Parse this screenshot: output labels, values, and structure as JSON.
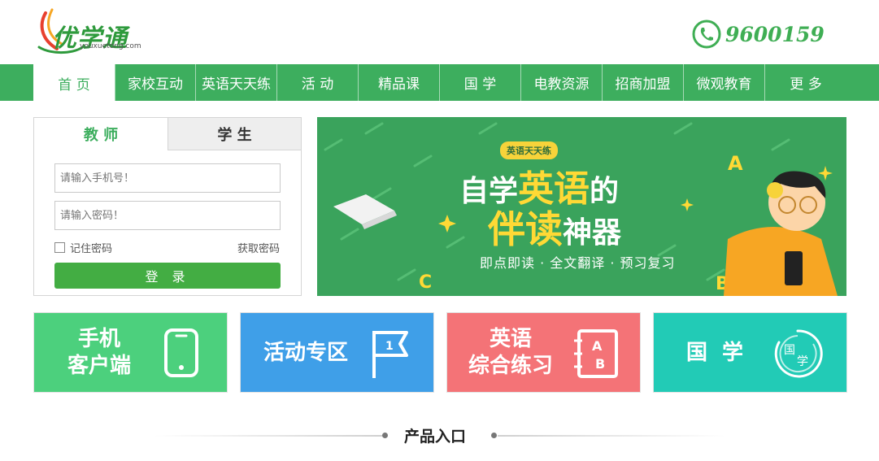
{
  "header": {
    "logo_text": "优学通",
    "logo_sub": "youxuetong.com",
    "phone": "9600159"
  },
  "nav": {
    "items": [
      {
        "label": "首  页"
      },
      {
        "label": "家校互动"
      },
      {
        "label": "英语天天练"
      },
      {
        "label": "活  动"
      },
      {
        "label": "精品课"
      },
      {
        "label": "国  学"
      },
      {
        "label": "电教资源"
      },
      {
        "label": "招商加盟"
      },
      {
        "label": "微观教育"
      },
      {
        "label": "更  多"
      }
    ]
  },
  "login": {
    "tab_teacher": "教 师",
    "tab_student": "学 生",
    "phone_placeholder": "请输入手机号！",
    "password_placeholder": "请输入密码！",
    "remember_label": "记住密码",
    "get_password": "获取密码",
    "submit": "登 录"
  },
  "banner": {
    "tag": "英语天天练",
    "line1_a": "自学",
    "line1_b": "英语",
    "line1_c": "的",
    "line2_a": "伴读",
    "line2_b": "神器",
    "sub": "即点即读 · 全文翻译 · 预习复习",
    "letters": [
      "A",
      "B",
      "C"
    ]
  },
  "tiles": [
    {
      "line1": "手机",
      "line2": "客户端",
      "color": "#4cd07d",
      "icon": "phone-icon"
    },
    {
      "line1": "活动专区",
      "line2": "",
      "color": "#3f9fe8",
      "icon": "flag-icon",
      "icon_text": "1"
    },
    {
      "line1": "英语",
      "line2": "综合练习",
      "color": "#f47377",
      "icon": "ab-book-icon",
      "icon_a": "A",
      "icon_b": "B"
    },
    {
      "line1": "国  学",
      "line2": "",
      "color": "#22cbb6",
      "icon": "guoxue-icon",
      "icon_a": "国",
      "icon_b": "学"
    }
  ],
  "section": {
    "title": "产品入口"
  },
  "colors": {
    "primary_green": "#3dae5e",
    "button_green": "#43ad43"
  }
}
